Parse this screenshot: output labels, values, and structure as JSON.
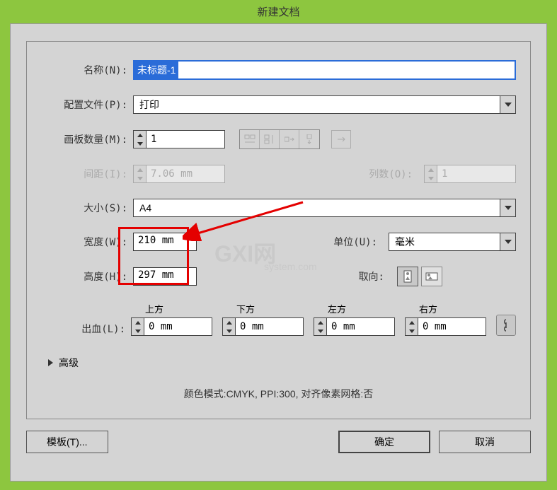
{
  "title": "新建文档",
  "name": {
    "label": "名称(N):",
    "value": "未标题-1"
  },
  "profile": {
    "label": "配置文件(P):",
    "value": "打印"
  },
  "artboards": {
    "label": "画板数量(M):",
    "value": "1"
  },
  "spacing": {
    "label": "间距(I):",
    "value": "7.06 mm"
  },
  "columns": {
    "label": "列数(O):",
    "value": "1"
  },
  "size": {
    "label": "大小(S):",
    "value": "A4"
  },
  "width": {
    "label": "宽度(W):",
    "value": "210 mm"
  },
  "height": {
    "label": "高度(H):",
    "value": "297 mm"
  },
  "units": {
    "label": "单位(U):",
    "value": "毫米"
  },
  "orientation": {
    "label": "取向:"
  },
  "bleed": {
    "label": "出血(L):",
    "top_label": "上方",
    "bottom_label": "下方",
    "left_label": "左方",
    "right_label": "右方",
    "top": "0 mm",
    "bottom": "0 mm",
    "left": "0 mm",
    "right": "0 mm"
  },
  "advanced": "高级",
  "info": "颜色模式:CMYK, PPI:300, 对齐像素网格:否",
  "buttons": {
    "template": "模板(T)...",
    "ok": "确定",
    "cancel": "取消"
  },
  "watermark": {
    "main": "GXI网",
    "sub": "system.com"
  }
}
